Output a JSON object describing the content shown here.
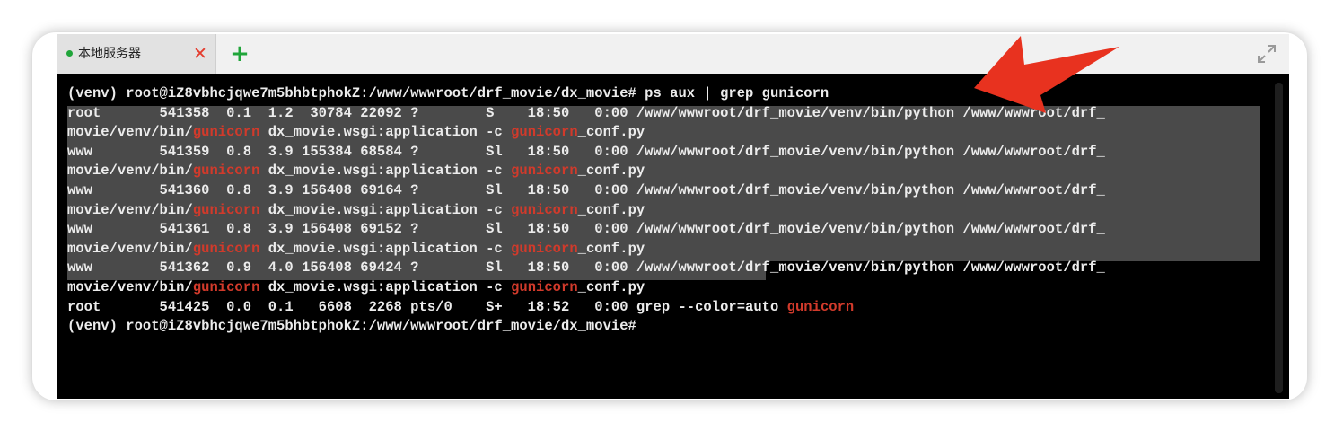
{
  "tab": {
    "title": "本地服务器",
    "close_glyph": "✕",
    "status_color": "#20a53a"
  },
  "add_tab_glyph": "+",
  "terminal": {
    "highlight_word": "gunicorn",
    "highlight_color": "#d13a2b",
    "lines": [
      {
        "segments": [
          "(venv) root@iZ8vbhcjqwe7m5bhbtphokZ:/www/wwwroot/drf_movie/dx_movie# ps aux | grep gunicorn"
        ]
      },
      {
        "segments": [
          "root       541358  0.1  1.2  30784 22092 ?        S    18:50   0:00 /www/wwwroot/drf_movie/venv/bin/python /www/wwwroot/drf_"
        ]
      },
      {
        "segments": [
          "movie/venv/bin/",
          "gunicorn",
          " dx_movie.wsgi:application -c ",
          "gunicorn",
          "_conf.py"
        ]
      },
      {
        "segments": [
          "www        541359  0.8  3.9 155384 68584 ?        Sl   18:50   0:00 /www/wwwroot/drf_movie/venv/bin/python /www/wwwroot/drf_"
        ]
      },
      {
        "segments": [
          "movie/venv/bin/",
          "gunicorn",
          " dx_movie.wsgi:application -c ",
          "gunicorn",
          "_conf.py"
        ]
      },
      {
        "segments": [
          "www        541360  0.8  3.9 156408 69164 ?        Sl   18:50   0:00 /www/wwwroot/drf_movie/venv/bin/python /www/wwwroot/drf_"
        ]
      },
      {
        "segments": [
          "movie/venv/bin/",
          "gunicorn",
          " dx_movie.wsgi:application -c ",
          "gunicorn",
          "_conf.py"
        ]
      },
      {
        "segments": [
          "www        541361  0.8  3.9 156408 69152 ?        Sl   18:50   0:00 /www/wwwroot/drf_movie/venv/bin/python /www/wwwroot/drf_"
        ]
      },
      {
        "segments": [
          "movie/venv/bin/",
          "gunicorn",
          " dx_movie.wsgi:application -c ",
          "gunicorn",
          "_conf.py"
        ]
      },
      {
        "segments": [
          "www        541362  0.9  4.0 156408 69424 ?        Sl   18:50   0:00 /www/wwwroot/drf_movie/venv/bin/python /www/wwwroot/drf_"
        ]
      },
      {
        "segments": [
          "movie/venv/bin/",
          "gunicorn",
          " dx_movie.wsgi:application -c ",
          "gunicorn",
          "_conf.py"
        ]
      },
      {
        "segments": [
          "root       541425  0.0  0.1   6608  2268 pts/0    S+   18:52   0:00 grep --color=auto ",
          "gunicorn"
        ]
      },
      {
        "segments": [
          "(venv) root@iZ8vbhcjqwe7m5bhbtphokZ:/www/wwwroot/drf_movie/dx_movie# "
        ]
      }
    ]
  },
  "icons": {
    "expand": "expand-icon",
    "annotation_arrow": "red-arrow-annotation",
    "arrow_color": "#e8321f"
  }
}
